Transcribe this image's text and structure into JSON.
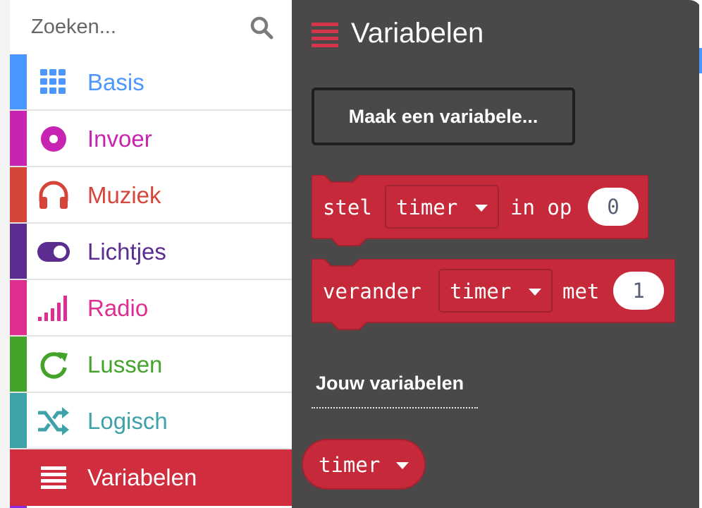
{
  "search": {
    "placeholder": "Zoeken...",
    "icon": "search-icon"
  },
  "colors": {
    "basis": "#4c97ff",
    "invoer": "#c724b1",
    "muziek": "#e0483c",
    "lichtjes": "#5c2d91",
    "radio": "#e3008c",
    "lussen": "#43a32b",
    "logisch": "#3ea2a8",
    "variabelen": "#dc143c",
    "flyout_bg": "#4a4849",
    "block_red": "#c5293a"
  },
  "sidebar": {
    "items": [
      {
        "label": "Basis",
        "icon": "grid-icon",
        "color": "#4c97ff"
      },
      {
        "label": "Invoer",
        "icon": "circle-dot-icon",
        "color": "#c724b1"
      },
      {
        "label": "Muziek",
        "icon": "headphones-icon",
        "color": "#d6453a"
      },
      {
        "label": "Lichtjes",
        "icon": "toggle-icon",
        "color": "#5c2d91"
      },
      {
        "label": "Radio",
        "icon": "signal-bars-icon",
        "color": "#df2e8f"
      },
      {
        "label": "Lussen",
        "icon": "refresh-icon",
        "color": "#43a32b"
      },
      {
        "label": "Logisch",
        "icon": "shuffle-icon",
        "color": "#3ea2a8"
      },
      {
        "label": "Variabelen",
        "icon": "list-icon",
        "color": "#dc3545",
        "selected": true
      }
    ]
  },
  "flyout": {
    "title": "Variabelen",
    "icon": "list-icon",
    "make_variable_button": "Maak een variabele...",
    "set_block": {
      "word1": "stel",
      "var": "timer",
      "word2": "in op",
      "value": "0"
    },
    "change_block": {
      "word1": "verander",
      "var": "timer",
      "word2": "met",
      "value": "1"
    },
    "section_label": "Jouw variabelen",
    "variable_reporter": {
      "name": "timer"
    }
  }
}
